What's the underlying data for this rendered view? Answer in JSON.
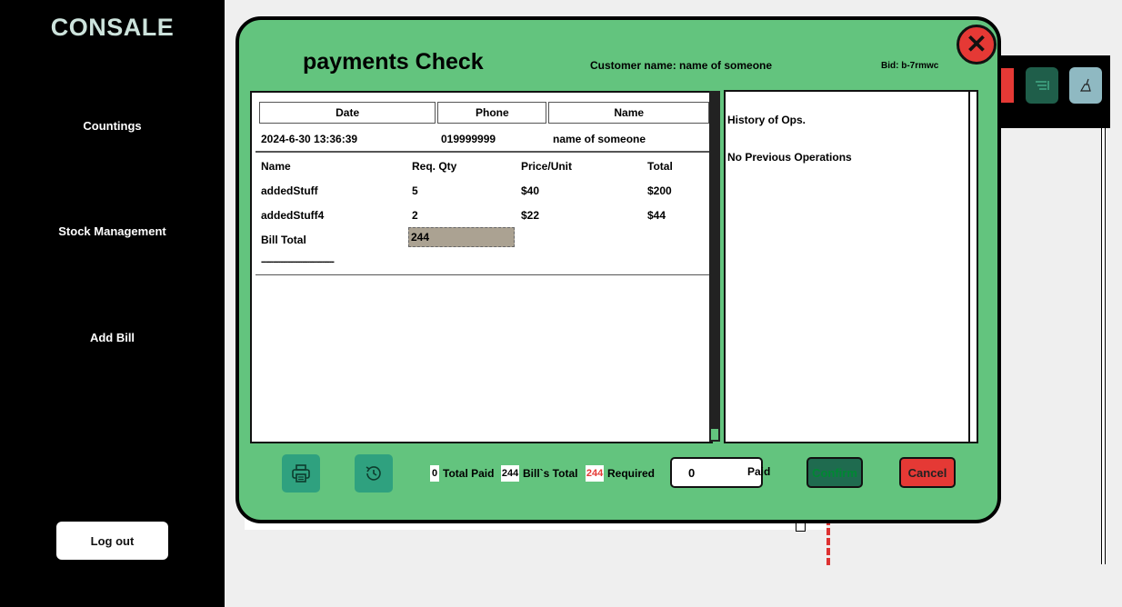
{
  "sidebar": {
    "brand": "CONSALE",
    "items": [
      {
        "label": "Countings"
      },
      {
        "label": "Stock Management"
      },
      {
        "label": "Add Bill"
      }
    ],
    "logout": "Log out"
  },
  "modal": {
    "title": "payments Check",
    "customer": "Customer name: name of someone",
    "bid": "Bid: b-7rmwc",
    "close_icon": "close-x-icon",
    "header_columns": [
      "Date",
      "Phone",
      "Name"
    ],
    "header_values": {
      "date": "2024-6-30 13:36:39",
      "phone": "019999999",
      "name": "name of someone"
    },
    "item_columns": [
      "Name",
      "Req. Qty",
      "Price/Unit",
      "Total"
    ],
    "items": [
      {
        "name": "addedStuff",
        "qty": "5",
        "price": "$40",
        "total": "$200"
      },
      {
        "name": "addedStuff4",
        "qty": "2",
        "price": "$22",
        "total": "$44"
      }
    ],
    "bill_total_label": "Bill Total",
    "bill_total_value": "244",
    "dashes": "------------------------------",
    "history_title": "History of Ops.",
    "history_empty": "No Previous Operations",
    "footer": {
      "print_icon": "printer-icon",
      "history_icon": "history-icon",
      "total_paid_value": "0",
      "total_paid_label": "Total Paid",
      "bills_total_value": "244",
      "bills_total_label": "Bill`s Total",
      "required_value": "244",
      "required_label": "Required",
      "paid_input_value": "0",
      "paid_label": "Paid",
      "confirm": "Confirm",
      "cancel": "Cancel"
    }
  },
  "colors": {
    "modal_bg": "#63c47e",
    "accent_teal": "#2fa17f",
    "confirm_bg": "#1f6b4f",
    "cancel_bg": "#e53935",
    "required_chip": "#e53935",
    "bill_total_box": "#aba292"
  }
}
